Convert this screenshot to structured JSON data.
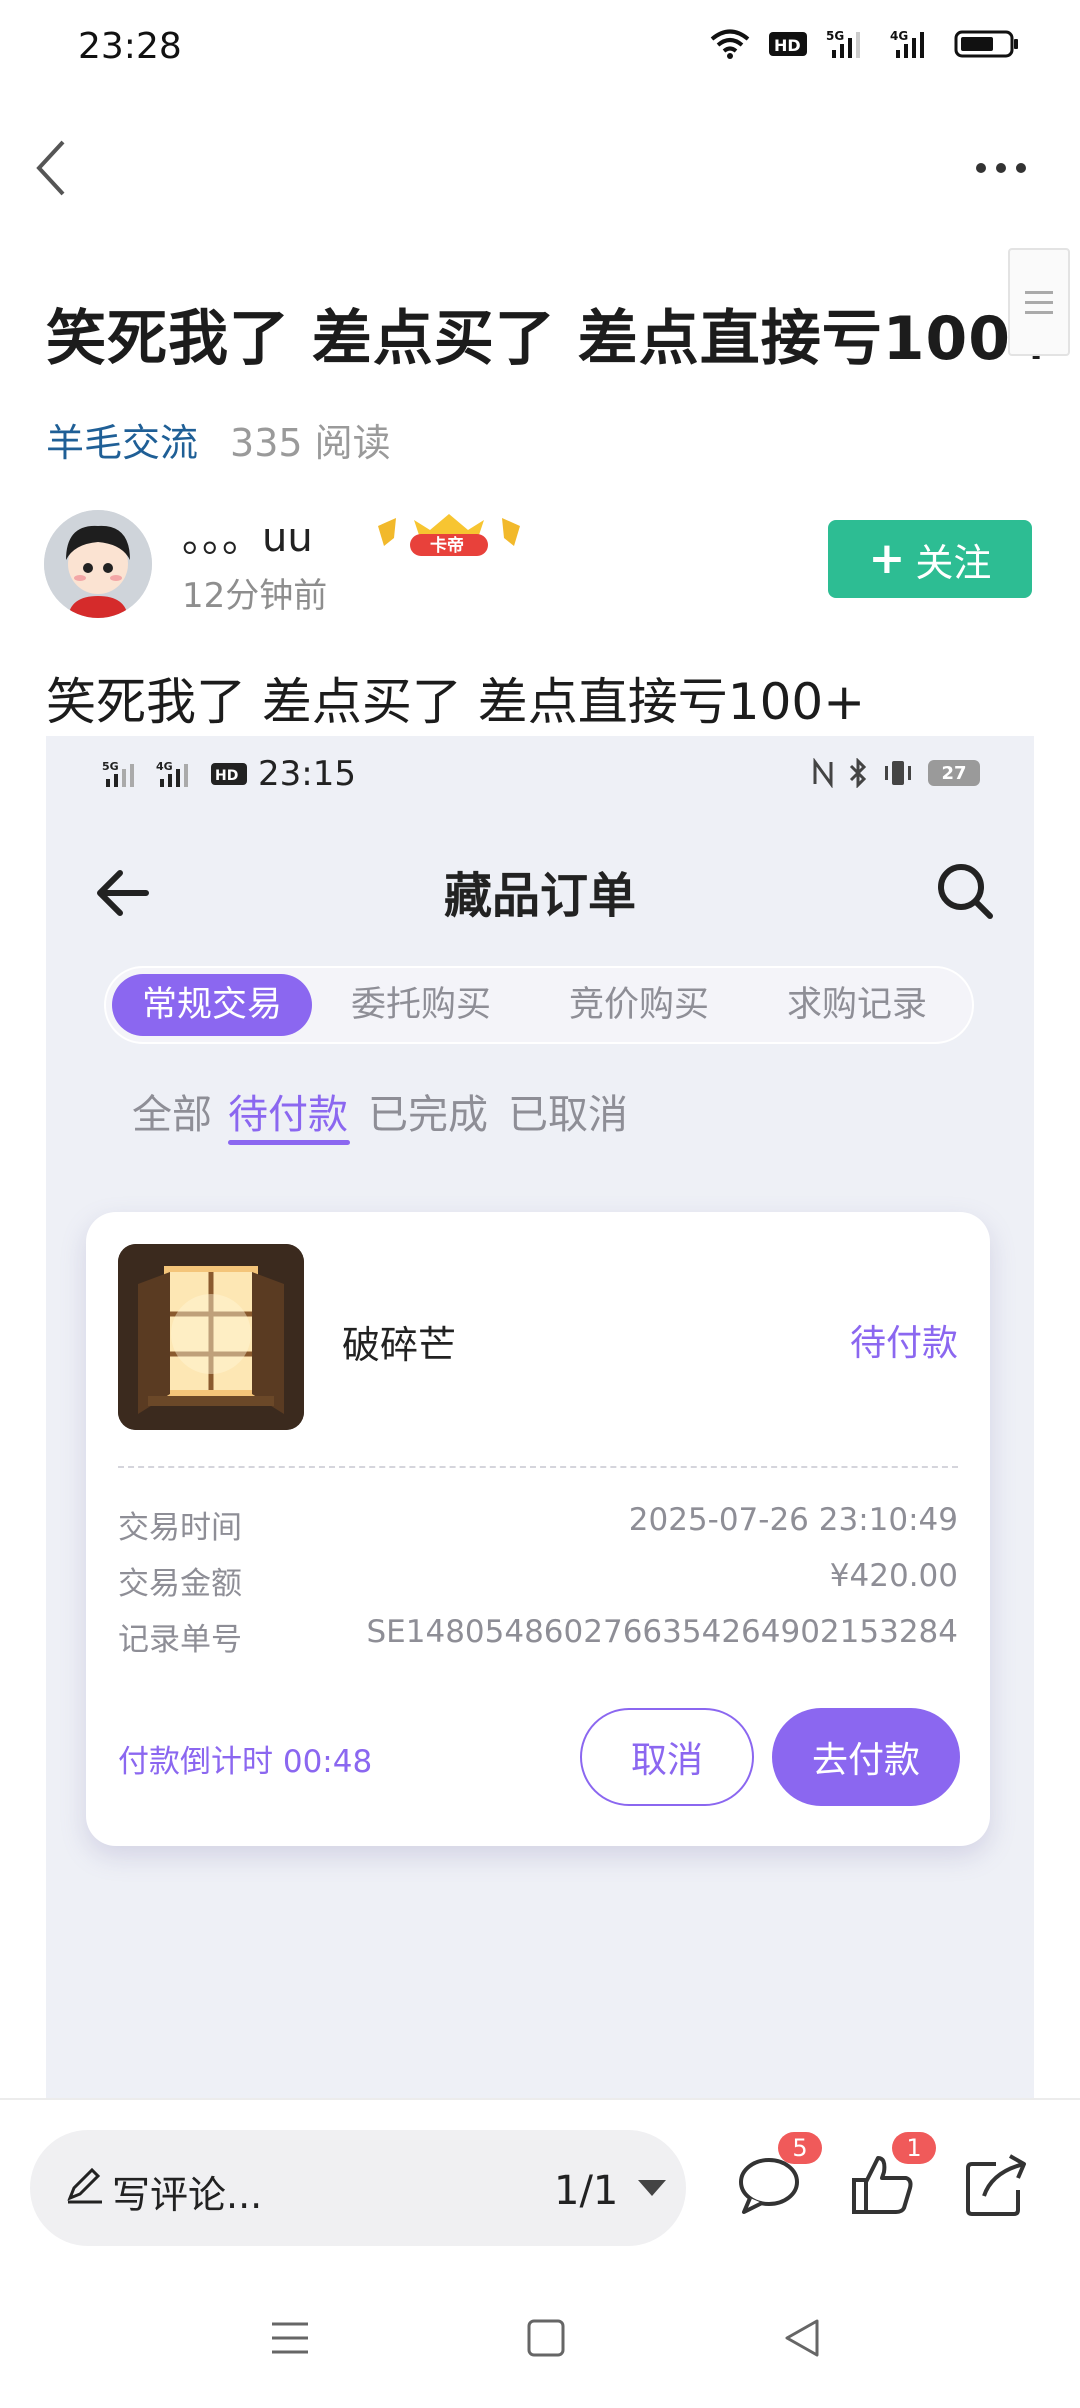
{
  "status_bar": {
    "time": "23:28",
    "icons": [
      "wifi-icon",
      "hd-icon",
      "signal-5g-icon",
      "signal-4g-icon",
      "battery-icon"
    ],
    "hd_text": "HD",
    "net1": "5G",
    "net2": "4G"
  },
  "post": {
    "title": "笑死我了 差点买了 差点直接亏100+",
    "topic": "羊毛交流",
    "reads": "335 阅读",
    "body": "笑死我了  差点买了  差点直接亏100+"
  },
  "author": {
    "name": "。。。uu",
    "badge_text": "卡帝",
    "time": "12分钟前",
    "follow_label": "关注"
  },
  "screenshot": {
    "status": {
      "net1": "5G",
      "net2": "4G",
      "hd": "HD",
      "time": "23:15",
      "battery": "27"
    },
    "title": "藏品订单",
    "segments": [
      "常规交易",
      "委托购买",
      "竞价购买",
      "求购记录"
    ],
    "active_segment": 0,
    "tabs": [
      "全部",
      "待付款",
      "已完成",
      "已取消"
    ],
    "active_tab": 1,
    "order": {
      "item_name": "破碎芒",
      "status": "待付款",
      "rows": [
        {
          "label": "交易时间",
          "value": "2025-07-26 23:10:49"
        },
        {
          "label": "交易金额",
          "value": "¥420.00"
        },
        {
          "label": "记录单号",
          "value": "SE14805486027663542649021532​84"
        }
      ],
      "countdown": "付款倒计时 00:48",
      "cancel_label": "取消",
      "pay_label": "去付款"
    },
    "colors": {
      "accent": "#8b67f0",
      "background": "#eef0f6"
    }
  },
  "bottom_bar": {
    "comment_placeholder": "写评论...",
    "page_indicator": "1/1",
    "comment_count": "5",
    "like_count": "1"
  },
  "colors": {
    "follow": "#2dbd93",
    "topic": "#1f5f96",
    "badge": "#f05a5a"
  }
}
